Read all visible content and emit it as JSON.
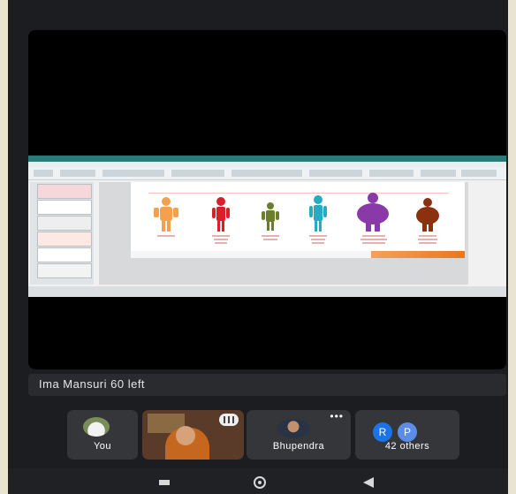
{
  "notice": {
    "text": "Ima Mansuri 60 left"
  },
  "participants": {
    "you": {
      "label": "You"
    },
    "bhupendra": {
      "label": "Bhupendra"
    },
    "others": {
      "label": "42 others",
      "chips": [
        "R",
        "P"
      ]
    }
  },
  "colors": {
    "chip_r": "#1a73e8",
    "chip_p": "#5b8de8",
    "panel": "#1c1d20",
    "stage": "#000000"
  },
  "icons": {
    "more": "three-dots-icon",
    "audio": "audio-level-icon"
  }
}
